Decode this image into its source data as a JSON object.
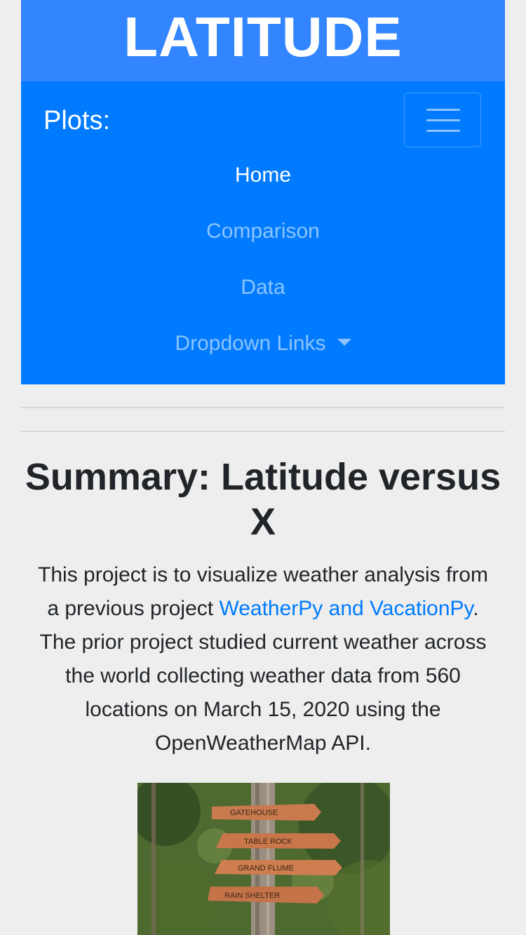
{
  "header": {
    "title": "LATITUDE"
  },
  "navbar": {
    "brand": "Plots:",
    "toggler_icon": "hamburger-menu-icon",
    "items": [
      {
        "label": "Home",
        "active": true
      },
      {
        "label": "Comparison",
        "active": false
      },
      {
        "label": "Data",
        "active": false
      },
      {
        "label": "Dropdown Links",
        "active": false,
        "dropdown": true
      }
    ]
  },
  "main": {
    "heading": "Summary: Latitude versus X",
    "paragraph": {
      "before_link": "This project is to visualize weather analysis from a previous project ",
      "link_text": "WeatherPy and VacationPy",
      "after_link": ". The prior project studied current weather across the world collecting weather data from 560 locations on March 15, 2020 using the OpenWeatherMap API."
    },
    "image_signs": [
      "GATEHOUSE",
      "TABLE ROCK",
      "GRAND FLUME",
      "RAIN SHELTER"
    ]
  },
  "colors": {
    "jumbotron": "#3385ff",
    "navbar": "#007bff",
    "link": "#007bff",
    "background": "#eeeeee"
  }
}
